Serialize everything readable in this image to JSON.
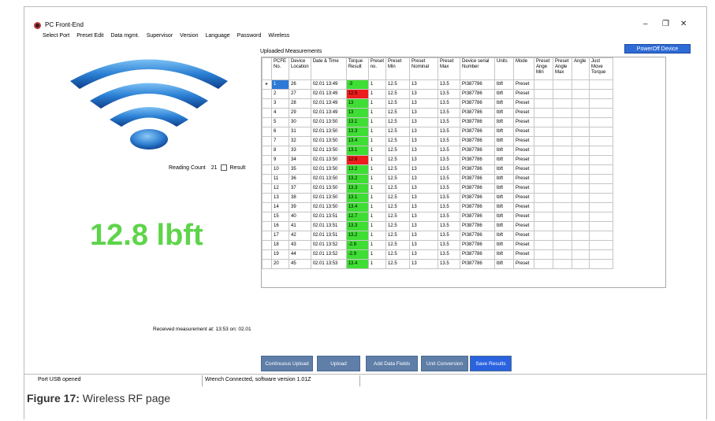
{
  "window": {
    "title": "PC Front-End",
    "controls": [
      "–",
      "❐",
      "✕"
    ]
  },
  "menu": [
    "Select Port",
    "Preset Edit",
    "Data mgmt.",
    "Supervisor",
    "Version",
    "Language",
    "Password",
    "Wireless"
  ],
  "poweroff_label": "PowerOff Device",
  "reading": {
    "label": "Reading Count",
    "count": "21",
    "result_label": "Result"
  },
  "big_value": "12.8 lbft",
  "received": "Received measurement at: 13:53  on: 02.01",
  "table": {
    "title": "Uploaded Measurements",
    "headers": [
      "PCFE No.",
      "Device Location",
      "Date & Time",
      "Torque Result",
      "Preset no.",
      "Preset Min",
      "Preset Nominal",
      "Preset Max",
      "Device serial Number",
      "Units",
      "Mode",
      "Preset Ange Min",
      "Preset Angle Max",
      "Angle",
      "Just Move Torque"
    ],
    "rows": [
      [
        "1",
        "26",
        "02.01 13:49",
        "-3",
        "1",
        "12.5",
        "13",
        "13.5",
        "PI387786",
        "lbft",
        "Preset",
        "",
        "",
        "",
        ""
      ],
      [
        "2",
        "27",
        "02.01 13:49",
        "12.5",
        "1",
        "12.5",
        "13",
        "13.5",
        "PI387786",
        "lbft",
        "Preset",
        "",
        "",
        "",
        ""
      ],
      [
        "3",
        "28",
        "02.01 13:49",
        "13",
        "1",
        "12.5",
        "13",
        "13.5",
        "PI387786",
        "lbft",
        "Preset",
        "",
        "",
        "",
        ""
      ],
      [
        "4",
        "29",
        "02.01 13:49",
        "13",
        "1",
        "12.5",
        "13",
        "13.5",
        "PI387786",
        "lbft",
        "Preset",
        "",
        "",
        "",
        ""
      ],
      [
        "5",
        "30",
        "02.01 13:50",
        "13.1",
        "1",
        "12.5",
        "13",
        "13.5",
        "PI387786",
        "lbft",
        "Preset",
        "",
        "",
        "",
        ""
      ],
      [
        "6",
        "31",
        "02.01 13:50",
        "13.3",
        "1",
        "12.5",
        "13",
        "13.5",
        "PI387786",
        "lbft",
        "Preset",
        "",
        "",
        "",
        ""
      ],
      [
        "7",
        "32",
        "02.01 13:50",
        "13.4",
        "1",
        "12.5",
        "13",
        "13.5",
        "PI387786",
        "lbft",
        "Preset",
        "",
        "",
        "",
        ""
      ],
      [
        "8",
        "33",
        "02.01 13:50",
        "13.1",
        "1",
        "12.5",
        "13",
        "13.5",
        "PI387786",
        "lbft",
        "Preset",
        "",
        "",
        "",
        ""
      ],
      [
        "9",
        "34",
        "02.01 13:50",
        "12.6",
        "1",
        "12.5",
        "13",
        "13.5",
        "PI387786",
        "lbft",
        "Preset",
        "",
        "",
        "",
        ""
      ],
      [
        "10",
        "35",
        "02.01 13:50",
        "13.2",
        "1",
        "12.5",
        "13",
        "13.5",
        "PI387786",
        "lbft",
        "Preset",
        "",
        "",
        "",
        ""
      ],
      [
        "11",
        "36",
        "02.01 13:50",
        "13.2",
        "1",
        "12.5",
        "13",
        "13.5",
        "PI387786",
        "lbft",
        "Preset",
        "",
        "",
        "",
        ""
      ],
      [
        "12",
        "37",
        "02.01 13:50",
        "13.3",
        "1",
        "12.5",
        "13",
        "13.5",
        "PI387786",
        "lbft",
        "Preset",
        "",
        "",
        "",
        ""
      ],
      [
        "13",
        "38",
        "02.01 13:50",
        "13.1",
        "1",
        "12.5",
        "13",
        "13.5",
        "PI387786",
        "lbft",
        "Preset",
        "",
        "",
        "",
        ""
      ],
      [
        "14",
        "39",
        "02.01 13:50",
        "13.4",
        "1",
        "12.5",
        "13",
        "13.5",
        "PI387786",
        "lbft",
        "Preset",
        "",
        "",
        "",
        ""
      ],
      [
        "15",
        "40",
        "02.01 13:51",
        "12.7",
        "1",
        "12.5",
        "13",
        "13.5",
        "PI387786",
        "lbft",
        "Preset",
        "",
        "",
        "",
        ""
      ],
      [
        "16",
        "41",
        "02.01 13:51",
        "13.3",
        "1",
        "12.5",
        "13",
        "13.5",
        "PI387786",
        "lbft",
        "Preset",
        "",
        "",
        "",
        ""
      ],
      [
        "17",
        "42",
        "02.01 13:51",
        "13.2",
        "1",
        "12.5",
        "13",
        "13.5",
        "PI387786",
        "lbft",
        "Preset",
        "",
        "",
        "",
        ""
      ],
      [
        "18",
        "43",
        "02.01 13:52",
        "-2.8",
        "1",
        "12.5",
        "13",
        "13.5",
        "PI387786",
        "lbft",
        "Preset",
        "",
        "",
        "",
        ""
      ],
      [
        "19",
        "44",
        "02.01 13:52",
        "-2.9",
        "1",
        "12.5",
        "13",
        "13.5",
        "PI387786",
        "lbft",
        "Preset",
        "",
        "",
        "",
        ""
      ],
      [
        "20",
        "45",
        "02.01 13:53",
        "13.4",
        "1",
        "12.5",
        "13",
        "13.5",
        "PI387786",
        "lbft",
        "Preset",
        "",
        "",
        "",
        ""
      ]
    ],
    "torque_status": [
      "g",
      "r",
      "g",
      "g",
      "g",
      "g",
      "g",
      "g",
      "r",
      "g",
      "g",
      "g",
      "g",
      "g",
      "g",
      "g",
      "g",
      "g",
      "g",
      "g"
    ],
    "selected_row": 0
  },
  "buttons": {
    "continuous": "Continuous Upload",
    "upload": "Upload",
    "add_fields": "Add Data Fields",
    "unit_conv": "Unit Conversion",
    "save": "Save Results"
  },
  "status": {
    "port": "Port USB opened",
    "wrench": "Wrench Connected, software version 1.01Z"
  },
  "caption": {
    "label": "Figure 17:",
    "text": "Wireless RF page"
  },
  "colors": {
    "ok": "#3fde34",
    "fail": "#ee1d1d",
    "big_text": "#5ed44a",
    "wifi": "#1f6fc6"
  }
}
